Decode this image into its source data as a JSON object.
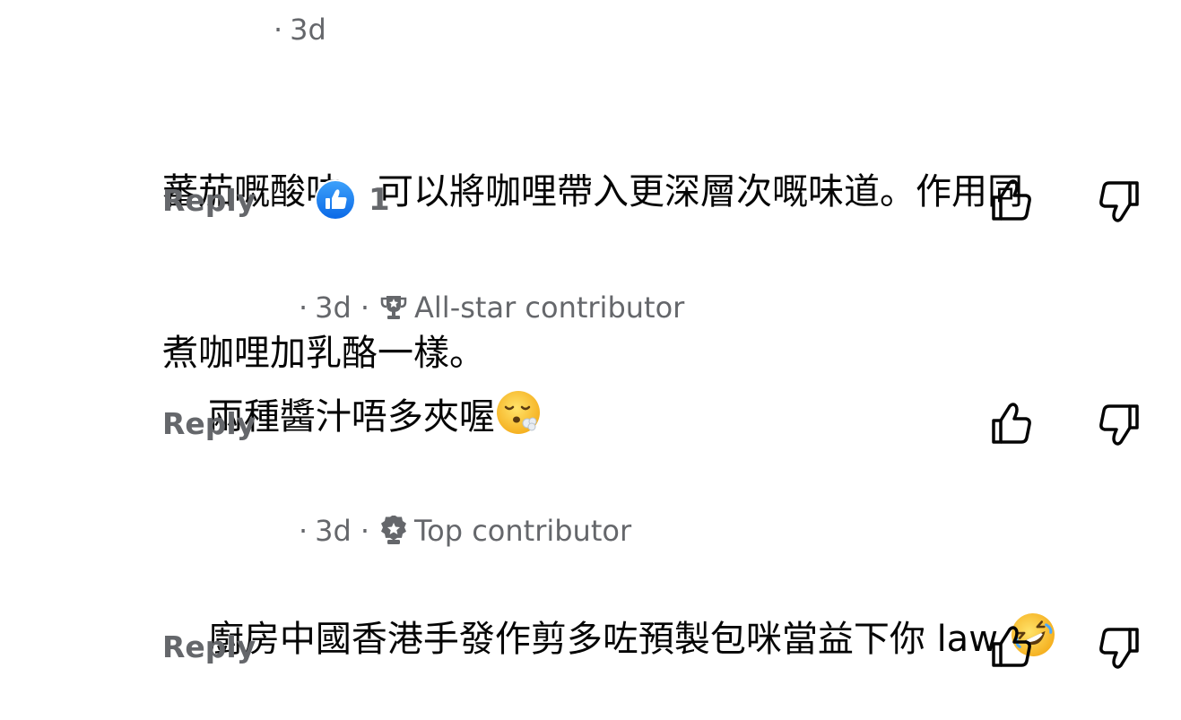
{
  "comments": [
    {
      "time": "3d",
      "badge": "",
      "text_lines": [
        "蕃茄嘅酸味，可以將咖哩帶入更深層次嘅味道。作用同",
        "煮咖哩加乳酪一樣。"
      ],
      "emoji": "",
      "reply_label": "Reply",
      "like_count": "1"
    },
    {
      "time": "3d",
      "badge": "All-star contributor",
      "badge_icon": "trophy-icon",
      "text": "兩種醬汁唔多夾喔",
      "emoji": "face-exhaling-icon",
      "reply_label": "Reply"
    },
    {
      "time": "3d",
      "badge": "Top contributor",
      "badge_icon": "medal-icon",
      "text": "廚房中國香港手發作剪多咗預製包咪當益下你 law ",
      "emoji": "rolling-on-floor-laughing-icon",
      "reply_label": "Reply"
    }
  ],
  "colors": {
    "meta": "#65676b",
    "text": "#050505",
    "like_blue": "#1877f2"
  }
}
